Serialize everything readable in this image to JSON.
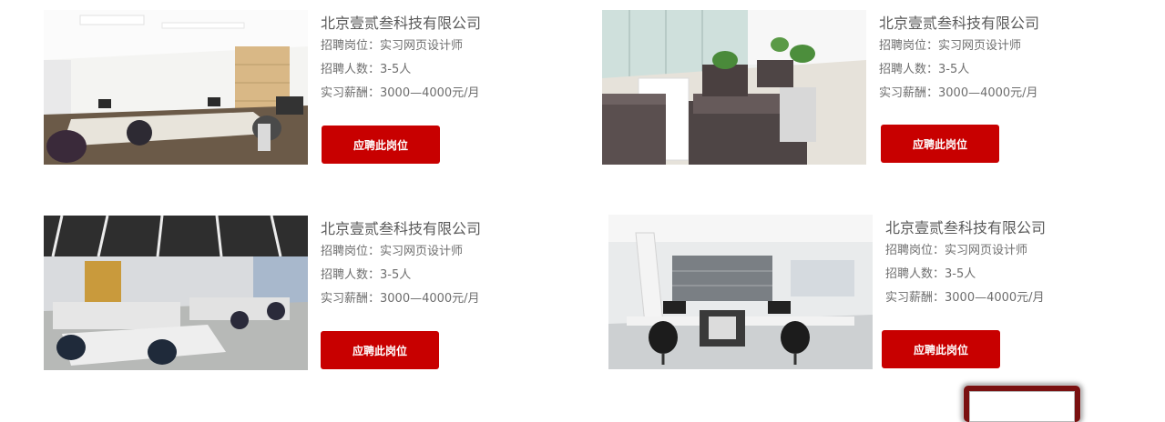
{
  "jobs": [
    {
      "company": "北京壹贰叁科技有限公司",
      "position": "招聘岗位：实习网页设计师",
      "headcount": "招聘人数：3-5人",
      "salary": "实习薪酬：3000—4000元/月",
      "apply_label": "应聘此岗位",
      "image": "office-workspace-photo"
    },
    {
      "company": "北京壹贰叁科技有限公司",
      "position": "招聘岗位：实习网页设计师",
      "headcount": "招聘人数：3-5人",
      "salary": "实习薪酬：3000—4000元/月",
      "apply_label": "应聘此岗位",
      "image": "lounge-sofas-photo"
    },
    {
      "company": "北京壹贰叁科技有限公司",
      "position": "招聘岗位：实习网页设计师",
      "headcount": "招聘人数：3-5人",
      "salary": "实习薪酬：3000—4000元/月",
      "apply_label": "应聘此岗位",
      "image": "open-plan-office-photo"
    },
    {
      "company": "北京壹贰叁科技有限公司",
      "position": "招聘岗位：实习网页设计师",
      "headcount": "招聘人数：3-5人",
      "salary": "实习薪酬：3000—4000元/月",
      "apply_label": "应聘此岗位",
      "image": "modern-desks-photo"
    }
  ],
  "colors": {
    "accent": "#c80000",
    "text": "#6b6b6b"
  }
}
